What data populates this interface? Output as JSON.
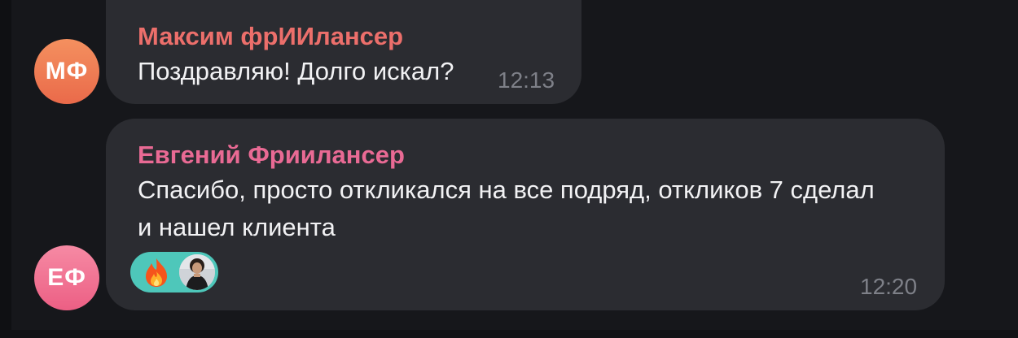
{
  "messages": [
    {
      "avatar_initials": "МФ",
      "avatar_color": "#ef7a55",
      "sender": "Максим фрИИлансер",
      "sender_color": "#ec6f6b",
      "text": "Поздравляю! Долго искал?",
      "time": "12:13"
    },
    {
      "avatar_initials": "ЕФ",
      "avatar_color": "#f06b8e",
      "sender": "Евгений Фриилансер",
      "sender_color": "#e96a94",
      "text": "Спасибо, просто откликался на все подряд, откликов 7 сделал\nи нашел клиента",
      "time": "12:20",
      "reaction": {
        "emoji_icon": "fire-icon",
        "reactor_avatar": "user-photo-avatar",
        "color": "#4ec7ba"
      }
    }
  ],
  "colors": {
    "background": "#16171b",
    "bubble": "#2b2c31",
    "text": "#f2f2f4",
    "time": "#7e8088"
  }
}
